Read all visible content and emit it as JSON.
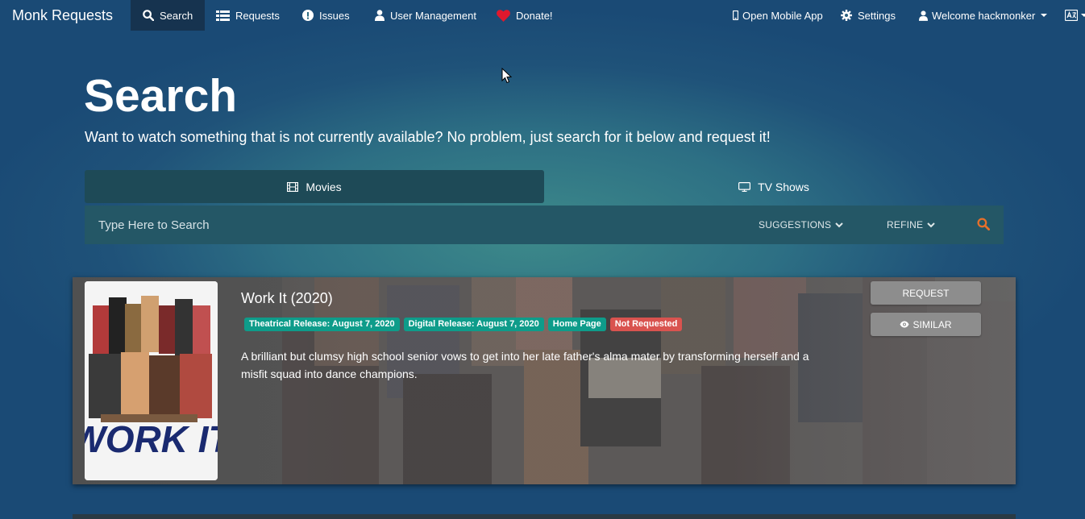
{
  "nav": {
    "brand": "Monk Requests",
    "items": [
      {
        "label": "Search",
        "icon": "search-icon"
      },
      {
        "label": "Requests",
        "icon": "list-icon"
      },
      {
        "label": "Issues",
        "icon": "exclamation-circle-icon"
      },
      {
        "label": "User Management",
        "icon": "user-icon"
      },
      {
        "label": "Donate!",
        "icon": "heart-icon"
      }
    ],
    "right": [
      {
        "label": "Open Mobile App",
        "icon": "mobile-icon"
      },
      {
        "label": "Settings",
        "icon": "gear-icon"
      },
      {
        "label": "Welcome hackmonker",
        "icon": "user-icon"
      }
    ],
    "language_icon": "language-icon"
  },
  "hero": {
    "title": "Search",
    "subtitle": "Want to watch something that is not currently available? No problem, just search for it below and request it!"
  },
  "tabs": [
    {
      "label": "Movies",
      "icon": "film-icon",
      "active": true
    },
    {
      "label": "TV Shows",
      "icon": "tv-icon",
      "active": false
    }
  ],
  "search": {
    "placeholder": "Type Here to Search",
    "suggestions_label": "SUGGESTIONS",
    "refine_label": "REFINE"
  },
  "result": {
    "title": "Work It (2020)",
    "poster_text": "WORK IT",
    "badges": [
      {
        "label": "Theatrical Release: August 7, 2020",
        "color": "#0e9c8a"
      },
      {
        "label": "Digital Release: August 7, 2020",
        "color": "#0e9c8a"
      },
      {
        "label": "Home Page",
        "color": "#0e9c8a"
      },
      {
        "label": "Not Requested",
        "color": "#d9534f"
      }
    ],
    "overview": "A brilliant but clumsy high school senior vows to get into her late father's alma mater by transforming herself and a misfit squad into dance champions.",
    "request_label": "REQUEST",
    "similar_label": "SIMILAR"
  },
  "colors": {
    "accent": "#e8702a",
    "navbar_active": "#16334f",
    "heart": "#e0182d"
  }
}
